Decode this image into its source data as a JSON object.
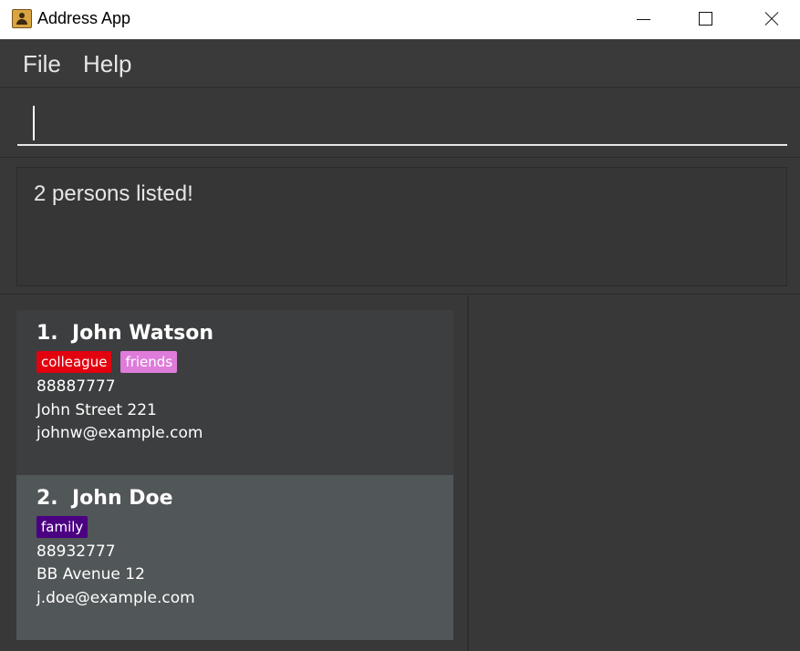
{
  "window": {
    "title": "Address App",
    "icon": "contact-book-icon"
  },
  "menu": {
    "file": "File",
    "help": "Help"
  },
  "command": {
    "value": "",
    "placeholder": ""
  },
  "result": {
    "text": "2 persons listed!"
  },
  "persons": [
    {
      "index": "1.",
      "name": "John Watson",
      "tags": [
        {
          "label": "colleague",
          "color": "#e3000f"
        },
        {
          "label": "friends",
          "color": "#df7cdb"
        }
      ],
      "phone": "88887777",
      "address": "John Street 221",
      "email": "johnw@example.com"
    },
    {
      "index": "2.",
      "name": "John Doe",
      "tags": [
        {
          "label": "family",
          "color": "#4b0082"
        }
      ],
      "phone": "88932777",
      "address": "BB Avenue 12",
      "email": "j.doe@example.com"
    }
  ],
  "colors": {
    "background": "#383838",
    "card_default": "#3c3e3f",
    "card_selected": "#515658"
  }
}
